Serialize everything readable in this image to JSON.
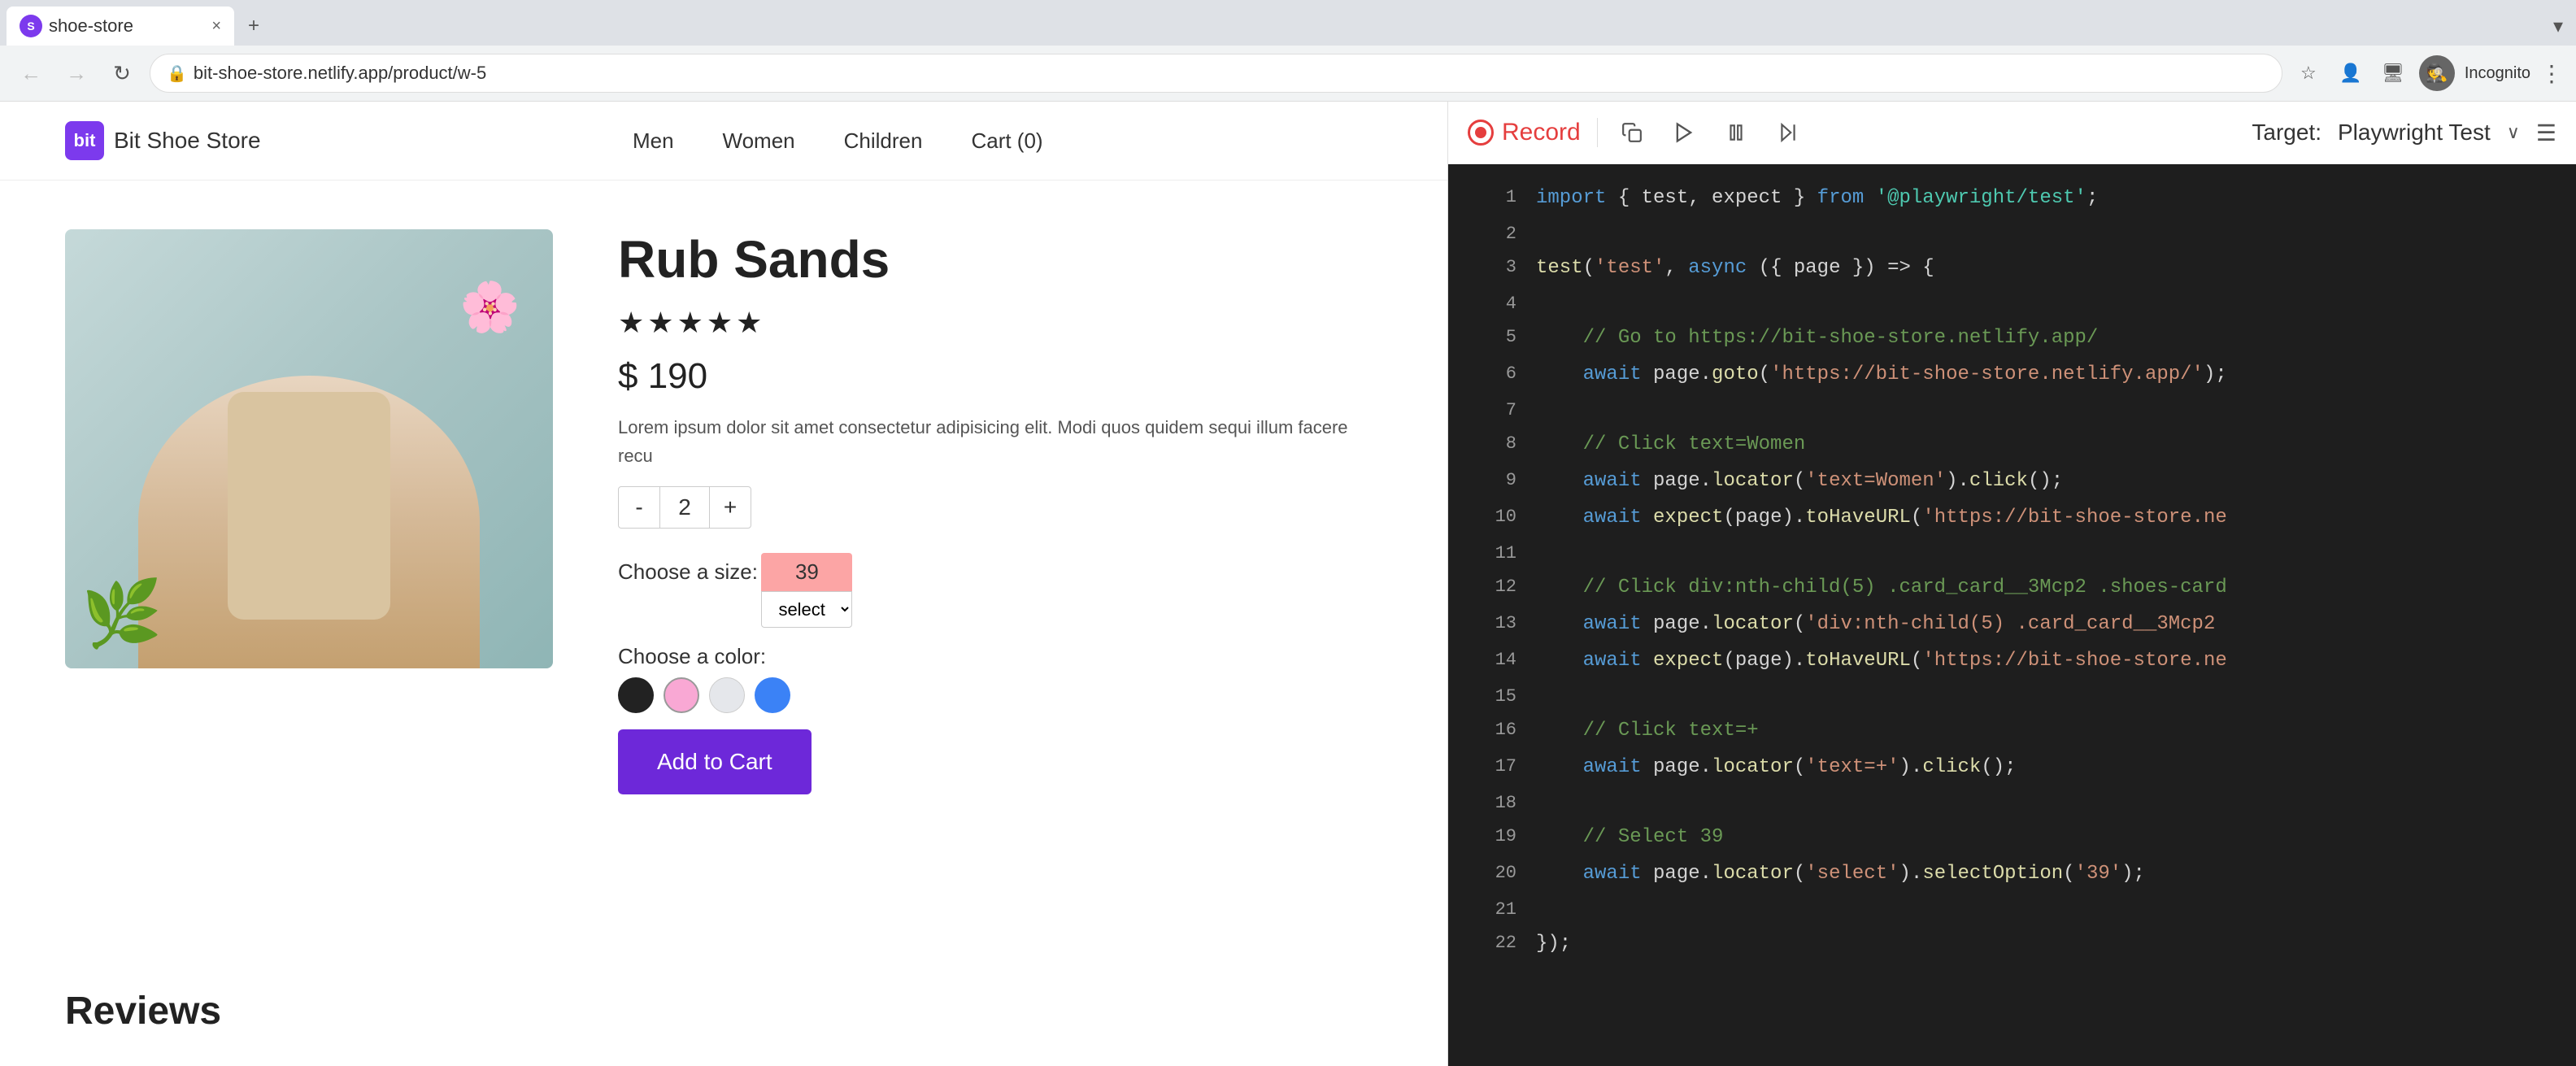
{
  "browser": {
    "tab": {
      "favicon_text": "S",
      "title": "shoe-store",
      "close_icon": "×",
      "new_tab_icon": "+"
    },
    "nav": {
      "back_icon": "←",
      "forward_icon": "→",
      "reload_icon": "↻",
      "url": "bit-shoe-store.netlify.app/product/w-5",
      "star_icon": "☆",
      "lock_icon": "🔒",
      "incognito_text": "Incognito",
      "menu_icon": "⋮"
    }
  },
  "site": {
    "logo_text": "bit",
    "title": "Bit Shoe Store",
    "nav": {
      "men": "Men",
      "women": "Women",
      "children": "Children",
      "cart": "Cart (0)"
    }
  },
  "product": {
    "name": "Rub Sands",
    "stars": "★★★★★",
    "price": "$ 190",
    "description": "Lorem ipsum dolor sit amet consectetur adipisicing elit. Modi quos quidem sequi illum facere recu",
    "quantity": "2",
    "qty_minus": "-",
    "qty_plus": "+",
    "size_label": "Choose a size:",
    "size_value": "39",
    "size_select_text": "select",
    "color_label": "Choose a color:",
    "colors": [
      "black",
      "pink",
      "white",
      "blue"
    ],
    "add_to_cart": "Add to Cart"
  },
  "reviews": {
    "title": "Reviews"
  },
  "editor": {
    "toolbar": {
      "record_label": "Record",
      "target_label": "Target:",
      "target_value": "Playwright Test",
      "chevron": "∨"
    },
    "lines": [
      {
        "num": 1,
        "tokens": [
          {
            "t": "kw",
            "v": "import"
          },
          {
            "t": "plain",
            "v": " { test, expect } "
          },
          {
            "t": "kw",
            "v": "from"
          },
          {
            "t": "plain",
            "v": " "
          },
          {
            "t": "str-green",
            "v": "'@playwright/test'"
          },
          {
            "t": "plain",
            "v": ";"
          }
        ]
      },
      {
        "num": 2,
        "tokens": []
      },
      {
        "num": 3,
        "tokens": [
          {
            "t": "fn-blue",
            "v": "test"
          },
          {
            "t": "plain",
            "v": "("
          },
          {
            "t": "str-orange",
            "v": "'test'"
          },
          {
            "t": "plain",
            "v": ", "
          },
          {
            "t": "kw",
            "v": "async"
          },
          {
            "t": "plain",
            "v": " ({ page }) => {"
          }
        ]
      },
      {
        "num": 4,
        "tokens": []
      },
      {
        "num": 5,
        "tokens": [
          {
            "t": "comment",
            "v": "    // Go to https://bit-shoe-store.netlify.app/"
          }
        ]
      },
      {
        "num": 6,
        "tokens": [
          {
            "t": "plain",
            "v": "    "
          },
          {
            "t": "kw",
            "v": "await"
          },
          {
            "t": "plain",
            "v": " page."
          },
          {
            "t": "fn-yellow",
            "v": "goto"
          },
          {
            "t": "plain",
            "v": "("
          },
          {
            "t": "str-orange",
            "v": "'https://bit-shoe-store.netlify.app/'"
          },
          {
            "t": "plain",
            "v": ");"
          }
        ]
      },
      {
        "num": 7,
        "tokens": []
      },
      {
        "num": 8,
        "tokens": [
          {
            "t": "comment",
            "v": "    // Click text=Women"
          }
        ]
      },
      {
        "num": 9,
        "tokens": [
          {
            "t": "plain",
            "v": "    "
          },
          {
            "t": "kw",
            "v": "await"
          },
          {
            "t": "plain",
            "v": " page."
          },
          {
            "t": "fn-yellow",
            "v": "locator"
          },
          {
            "t": "plain",
            "v": "("
          },
          {
            "t": "str-orange",
            "v": "'text=Women'"
          },
          {
            "t": "plain",
            "v": ")."
          },
          {
            "t": "fn-yellow",
            "v": "click"
          },
          {
            "t": "plain",
            "v": "();"
          }
        ]
      },
      {
        "num": 10,
        "tokens": [
          {
            "t": "plain",
            "v": "    "
          },
          {
            "t": "kw",
            "v": "await"
          },
          {
            "t": "plain",
            "v": " "
          },
          {
            "t": "fn-yellow",
            "v": "expect"
          },
          {
            "t": "plain",
            "v": "(page)."
          },
          {
            "t": "fn-yellow",
            "v": "toHaveURL"
          },
          {
            "t": "plain",
            "v": "("
          },
          {
            "t": "str-orange",
            "v": "'https://bit-shoe-store.ne"
          },
          {
            "t": "plain",
            "v": ""
          }
        ]
      },
      {
        "num": 11,
        "tokens": []
      },
      {
        "num": 12,
        "tokens": [
          {
            "t": "comment",
            "v": "    // Click div:nth-child(5) .card_card__3Mcp2 .shoes-card"
          }
        ]
      },
      {
        "num": 13,
        "tokens": [
          {
            "t": "plain",
            "v": "    "
          },
          {
            "t": "kw",
            "v": "await"
          },
          {
            "t": "plain",
            "v": " page."
          },
          {
            "t": "fn-yellow",
            "v": "locator"
          },
          {
            "t": "plain",
            "v": "("
          },
          {
            "t": "str-orange",
            "v": "'div:nth-child(5) .card_card__3Mcp2"
          },
          {
            "t": "plain",
            "v": ""
          }
        ]
      },
      {
        "num": 14,
        "tokens": [
          {
            "t": "plain",
            "v": "    "
          },
          {
            "t": "kw",
            "v": "await"
          },
          {
            "t": "plain",
            "v": " "
          },
          {
            "t": "fn-yellow",
            "v": "expect"
          },
          {
            "t": "plain",
            "v": "(page)."
          },
          {
            "t": "fn-yellow",
            "v": "toHaveURL"
          },
          {
            "t": "plain",
            "v": "("
          },
          {
            "t": "str-orange",
            "v": "'https://bit-shoe-store.ne"
          }
        ]
      },
      {
        "num": 15,
        "tokens": []
      },
      {
        "num": 16,
        "tokens": [
          {
            "t": "comment",
            "v": "    // Click text=+"
          }
        ]
      },
      {
        "num": 17,
        "tokens": [
          {
            "t": "plain",
            "v": "    "
          },
          {
            "t": "kw",
            "v": "await"
          },
          {
            "t": "plain",
            "v": " page."
          },
          {
            "t": "fn-yellow",
            "v": "locator"
          },
          {
            "t": "plain",
            "v": "("
          },
          {
            "t": "str-orange",
            "v": "'text=+'"
          },
          {
            "t": "plain",
            "v": ")."
          },
          {
            "t": "fn-yellow",
            "v": "click"
          },
          {
            "t": "plain",
            "v": "();"
          }
        ]
      },
      {
        "num": 18,
        "tokens": []
      },
      {
        "num": 19,
        "tokens": [
          {
            "t": "comment",
            "v": "    // Select 39"
          }
        ]
      },
      {
        "num": 20,
        "tokens": [
          {
            "t": "plain",
            "v": "    "
          },
          {
            "t": "kw",
            "v": "await"
          },
          {
            "t": "plain",
            "v": " page."
          },
          {
            "t": "fn-yellow",
            "v": "locator"
          },
          {
            "t": "plain",
            "v": "("
          },
          {
            "t": "str-orange",
            "v": "'select'"
          },
          {
            "t": "plain",
            "v": ")."
          },
          {
            "t": "fn-yellow",
            "v": "selectOption"
          },
          {
            "t": "plain",
            "v": "("
          },
          {
            "t": "str-orange",
            "v": "'39'"
          },
          {
            "t": "plain",
            "v": ");"
          }
        ]
      },
      {
        "num": 21,
        "tokens": []
      },
      {
        "num": 22,
        "tokens": [
          {
            "t": "plain",
            "v": "});"
          }
        ]
      }
    ]
  }
}
